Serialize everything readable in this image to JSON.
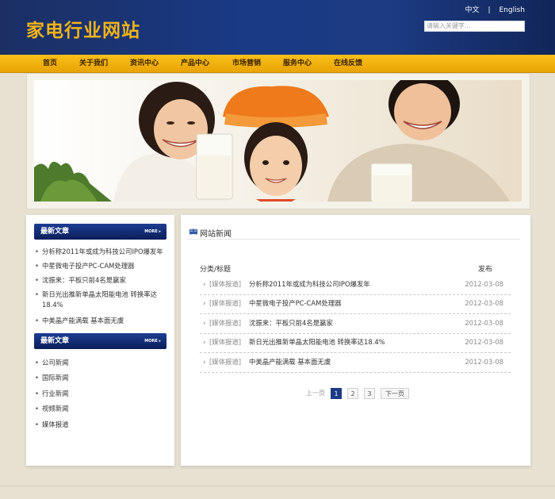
{
  "header": {
    "site_title": "家电行业网站",
    "lang_cn": "中文",
    "lang_sep": "|",
    "lang_en": "English",
    "search_placeholder": "请输入关键字..."
  },
  "nav": {
    "items": [
      "首页",
      "关于我们",
      "资讯中心",
      "产品中心",
      "市场营销",
      "服务中心",
      "在线反馈"
    ]
  },
  "left_box1": {
    "title": "最新文章",
    "more": "MORE ▸",
    "items": [
      "分析称2011年或成为科技公司IPO爆发年",
      "中星微电子投产PC-CAM处理器",
      "沈振来：平板只前4名是赢家",
      "新日光出推新单晶太阳能电池 转换率达18.4%",
      "中美晶产能满载 基本面无虞"
    ]
  },
  "left_box2": {
    "title": "最新文章",
    "more": "MORE ▸",
    "items": [
      "公司新闻",
      "国际新闻",
      "行业新闻",
      "视频新闻",
      "媒体报道"
    ]
  },
  "news": {
    "heading": "网站新闻",
    "col_title": "分类/标题",
    "col_date": "发布",
    "rows": [
      {
        "cat": "[媒体报道]",
        "title": "分析称2011年或成为科技公司IPO爆发年",
        "date": "2012-03-08"
      },
      {
        "cat": "[媒体报道]",
        "title": "中星微电子投产PC-CAM处理器",
        "date": "2012-03-08"
      },
      {
        "cat": "[媒体报道]",
        "title": "沈振来：平板只前4名是赢家",
        "date": "2012-03-08"
      },
      {
        "cat": "[媒体报道]",
        "title": "新日光出推新单晶太阳能电池 转换率达18.4%",
        "date": "2012-03-08"
      },
      {
        "cat": "[媒体报道]",
        "title": "中美晶产能满载 基本面无虞",
        "date": "2012-03-08"
      }
    ]
  },
  "pager": {
    "prev": "上一页",
    "pages": [
      "1",
      "2",
      "3"
    ],
    "next": "下一页"
  },
  "colors": {
    "header_blue": "#1a3a86",
    "nav_orange": "#f4b41a",
    "title_yellow": "#f4b41a"
  }
}
